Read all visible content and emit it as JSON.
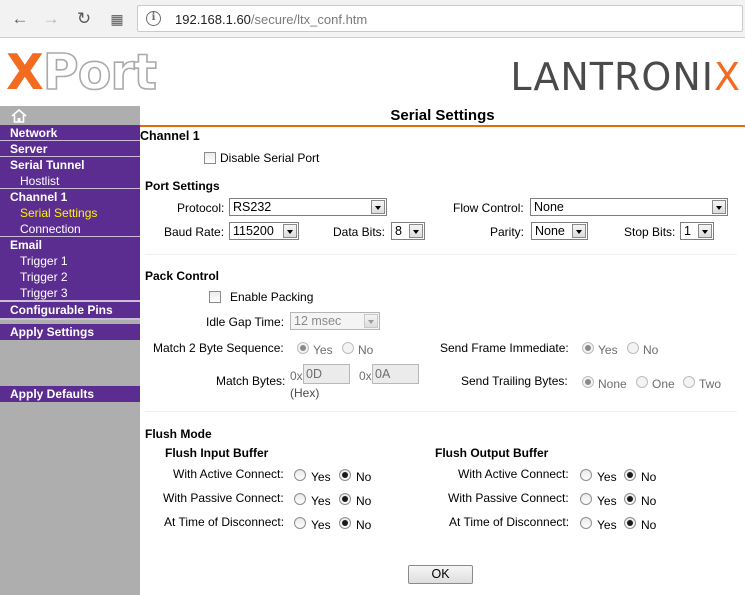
{
  "browser": {
    "url_host": "192.168.1.60",
    "url_path": "/secure/ltx_conf.htm"
  },
  "header": {
    "xport_x": "X",
    "xport_rest": "Port",
    "brand_main": "LANTRONI",
    "brand_x": "X"
  },
  "sidebar": {
    "network": "Network",
    "server": "Server",
    "serial_tunnel": "Serial Tunnel",
    "hostlist": "Hostlist",
    "channel1": "Channel 1",
    "serial_settings": "Serial Settings",
    "connection": "Connection",
    "email": "Email",
    "trigger1": "Trigger 1",
    "trigger2": "Trigger 2",
    "trigger3": "Trigger 3",
    "configurable_pins": "Configurable Pins",
    "apply_settings": "Apply Settings",
    "apply_defaults": "Apply Defaults"
  },
  "main": {
    "title": "Serial Settings",
    "channel": "Channel 1",
    "disable_serial_port": "Disable Serial Port",
    "port_settings": {
      "heading": "Port Settings",
      "protocol_label": "Protocol:",
      "protocol_value": "RS232",
      "flow_control_label": "Flow Control:",
      "flow_control_value": "None",
      "baud_rate_label": "Baud Rate:",
      "baud_rate_value": "115200",
      "data_bits_label": "Data Bits:",
      "data_bits_value": "8",
      "parity_label": "Parity:",
      "parity_value": "None",
      "stop_bits_label": "Stop Bits:",
      "stop_bits_value": "1"
    },
    "pack_control": {
      "heading": "Pack Control",
      "enable_packing": "Enable Packing",
      "idle_gap_label": "Idle Gap Time:",
      "idle_gap_value": "12 msec",
      "match2_label": "Match 2 Byte Sequence:",
      "send_frame_label": "Send Frame Immediate:",
      "yes": "Yes",
      "no": "No",
      "match_bytes_label": "Match Bytes:",
      "hex_prefix": "0x",
      "match_byte1": "0D",
      "match_byte2": "0A",
      "hex_note": "(Hex)",
      "send_trailing_label": "Send Trailing Bytes:",
      "trailing_none": "None",
      "trailing_one": "One",
      "trailing_two": "Two"
    },
    "flush_mode": {
      "heading": "Flush Mode",
      "input_heading": "Flush Input Buffer",
      "output_heading": "Flush Output Buffer",
      "active": "With Active Connect:",
      "passive": "With Passive Connect:",
      "disconnect": "At Time of Disconnect:",
      "yes": "Yes",
      "no": "No"
    },
    "ok_button": "OK"
  }
}
